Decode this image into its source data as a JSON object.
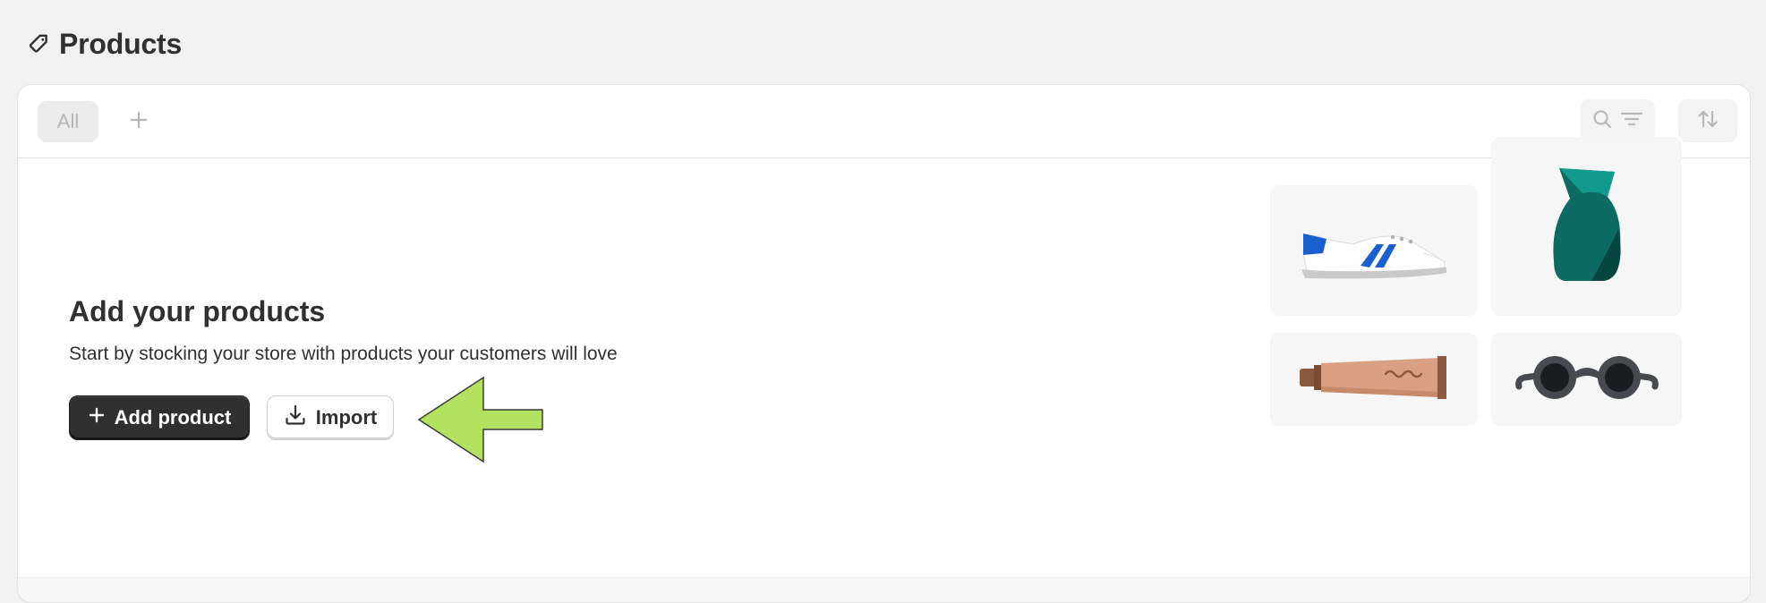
{
  "page": {
    "title": "Products",
    "title_icon": "tag-icon"
  },
  "toolbar": {
    "tabs": [
      {
        "label": "All",
        "selected": true
      }
    ],
    "add_view_icon": "plus-icon",
    "search_filter_icons": [
      "search-icon",
      "filter-lines-icon"
    ],
    "sort_icon": "sort-arrows-icon"
  },
  "empty_state": {
    "heading": "Add your products",
    "description": "Start by stocking your store with products your customers will love",
    "primary_button": {
      "label": "Add product",
      "icon": "plus-icon"
    },
    "secondary_button": {
      "label": "Import",
      "icon": "download-icon"
    }
  },
  "annotation": {
    "icon": "arrow-left-icon",
    "color": "#b3e261"
  },
  "illustrations": [
    "sneaker-icon",
    "vase-icon",
    "tube-icon",
    "sunglasses-icon"
  ],
  "colors": {
    "primary_button_bg": "#303030",
    "page_bg": "#f1f1f1",
    "card_bg": "#ffffff"
  }
}
